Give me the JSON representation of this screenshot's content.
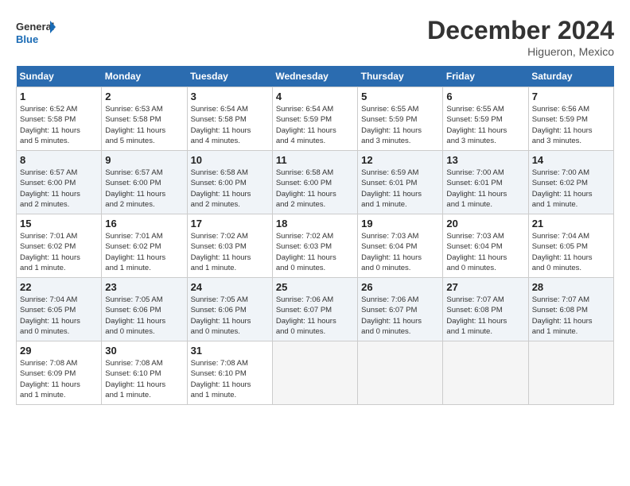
{
  "logo": {
    "line1": "General",
    "line2": "Blue"
  },
  "title": "December 2024",
  "subtitle": "Higueron, Mexico",
  "headers": [
    "Sunday",
    "Monday",
    "Tuesday",
    "Wednesday",
    "Thursday",
    "Friday",
    "Saturday"
  ],
  "weeks": [
    [
      {
        "day": "1",
        "info": "Sunrise: 6:52 AM\nSunset: 5:58 PM\nDaylight: 11 hours\nand 5 minutes."
      },
      {
        "day": "2",
        "info": "Sunrise: 6:53 AM\nSunset: 5:58 PM\nDaylight: 11 hours\nand 5 minutes."
      },
      {
        "day": "3",
        "info": "Sunrise: 6:54 AM\nSunset: 5:58 PM\nDaylight: 11 hours\nand 4 minutes."
      },
      {
        "day": "4",
        "info": "Sunrise: 6:54 AM\nSunset: 5:59 PM\nDaylight: 11 hours\nand 4 minutes."
      },
      {
        "day": "5",
        "info": "Sunrise: 6:55 AM\nSunset: 5:59 PM\nDaylight: 11 hours\nand 3 minutes."
      },
      {
        "day": "6",
        "info": "Sunrise: 6:55 AM\nSunset: 5:59 PM\nDaylight: 11 hours\nand 3 minutes."
      },
      {
        "day": "7",
        "info": "Sunrise: 6:56 AM\nSunset: 5:59 PM\nDaylight: 11 hours\nand 3 minutes."
      }
    ],
    [
      {
        "day": "8",
        "info": "Sunrise: 6:57 AM\nSunset: 6:00 PM\nDaylight: 11 hours\nand 2 minutes."
      },
      {
        "day": "9",
        "info": "Sunrise: 6:57 AM\nSunset: 6:00 PM\nDaylight: 11 hours\nand 2 minutes."
      },
      {
        "day": "10",
        "info": "Sunrise: 6:58 AM\nSunset: 6:00 PM\nDaylight: 11 hours\nand 2 minutes."
      },
      {
        "day": "11",
        "info": "Sunrise: 6:58 AM\nSunset: 6:00 PM\nDaylight: 11 hours\nand 2 minutes."
      },
      {
        "day": "12",
        "info": "Sunrise: 6:59 AM\nSunset: 6:01 PM\nDaylight: 11 hours\nand 1 minute."
      },
      {
        "day": "13",
        "info": "Sunrise: 7:00 AM\nSunset: 6:01 PM\nDaylight: 11 hours\nand 1 minute."
      },
      {
        "day": "14",
        "info": "Sunrise: 7:00 AM\nSunset: 6:02 PM\nDaylight: 11 hours\nand 1 minute."
      }
    ],
    [
      {
        "day": "15",
        "info": "Sunrise: 7:01 AM\nSunset: 6:02 PM\nDaylight: 11 hours\nand 1 minute."
      },
      {
        "day": "16",
        "info": "Sunrise: 7:01 AM\nSunset: 6:02 PM\nDaylight: 11 hours\nand 1 minute."
      },
      {
        "day": "17",
        "info": "Sunrise: 7:02 AM\nSunset: 6:03 PM\nDaylight: 11 hours\nand 1 minute."
      },
      {
        "day": "18",
        "info": "Sunrise: 7:02 AM\nSunset: 6:03 PM\nDaylight: 11 hours\nand 0 minutes."
      },
      {
        "day": "19",
        "info": "Sunrise: 7:03 AM\nSunset: 6:04 PM\nDaylight: 11 hours\nand 0 minutes."
      },
      {
        "day": "20",
        "info": "Sunrise: 7:03 AM\nSunset: 6:04 PM\nDaylight: 11 hours\nand 0 minutes."
      },
      {
        "day": "21",
        "info": "Sunrise: 7:04 AM\nSunset: 6:05 PM\nDaylight: 11 hours\nand 0 minutes."
      }
    ],
    [
      {
        "day": "22",
        "info": "Sunrise: 7:04 AM\nSunset: 6:05 PM\nDaylight: 11 hours\nand 0 minutes."
      },
      {
        "day": "23",
        "info": "Sunrise: 7:05 AM\nSunset: 6:06 PM\nDaylight: 11 hours\nand 0 minutes."
      },
      {
        "day": "24",
        "info": "Sunrise: 7:05 AM\nSunset: 6:06 PM\nDaylight: 11 hours\nand 0 minutes."
      },
      {
        "day": "25",
        "info": "Sunrise: 7:06 AM\nSunset: 6:07 PM\nDaylight: 11 hours\nand 0 minutes."
      },
      {
        "day": "26",
        "info": "Sunrise: 7:06 AM\nSunset: 6:07 PM\nDaylight: 11 hours\nand 0 minutes."
      },
      {
        "day": "27",
        "info": "Sunrise: 7:07 AM\nSunset: 6:08 PM\nDaylight: 11 hours\nand 1 minute."
      },
      {
        "day": "28",
        "info": "Sunrise: 7:07 AM\nSunset: 6:08 PM\nDaylight: 11 hours\nand 1 minute."
      }
    ],
    [
      {
        "day": "29",
        "info": "Sunrise: 7:08 AM\nSunset: 6:09 PM\nDaylight: 11 hours\nand 1 minute."
      },
      {
        "day": "30",
        "info": "Sunrise: 7:08 AM\nSunset: 6:10 PM\nDaylight: 11 hours\nand 1 minute."
      },
      {
        "day": "31",
        "info": "Sunrise: 7:08 AM\nSunset: 6:10 PM\nDaylight: 11 hours\nand 1 minute."
      },
      null,
      null,
      null,
      null
    ]
  ]
}
